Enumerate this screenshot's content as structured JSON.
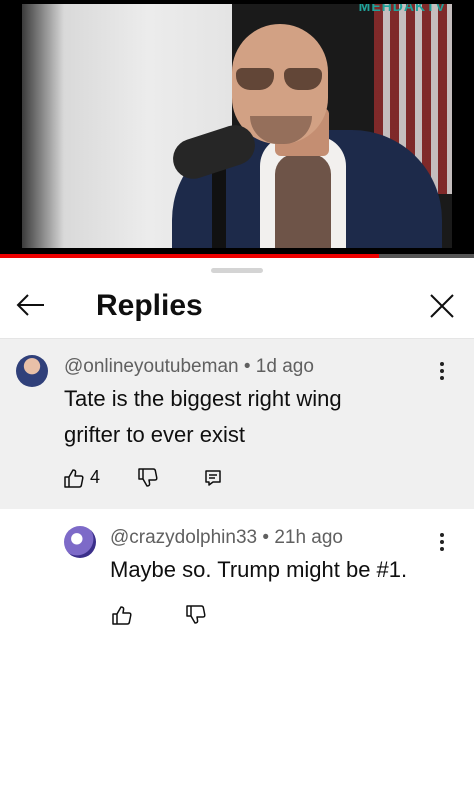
{
  "video": {
    "watermark": "MEHDAKTV",
    "progress_fraction": 0.8
  },
  "sheet": {
    "title": "Replies"
  },
  "main_comment": {
    "author": "@onlineyoutubeman",
    "separator": "•",
    "time": "1d ago",
    "text": "Tate is the biggest right wing grifter to ever exist",
    "likes": "4"
  },
  "reply": {
    "author": "@crazydolphin33",
    "separator": "•",
    "time": "21h ago",
    "text": "Maybe so. Trump might be #1."
  },
  "icons": {
    "back": "arrow-left-icon",
    "close": "close-icon",
    "like": "thumb-up-icon",
    "dislike": "thumb-down-icon",
    "reply": "reply-icon",
    "more": "more-vertical-icon"
  },
  "colors": {
    "progress": "#ee0000",
    "highlight_bg": "#f0f0f0",
    "meta_text": "#606060"
  }
}
